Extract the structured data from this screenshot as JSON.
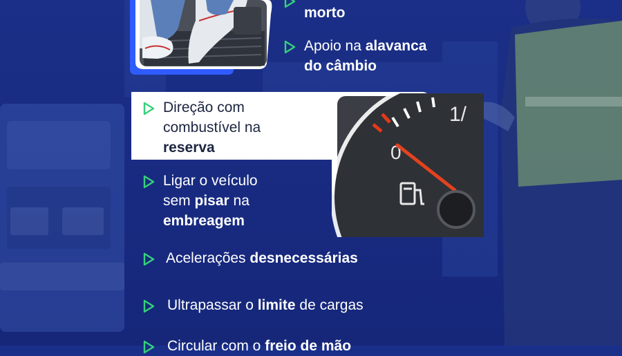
{
  "colors": {
    "background": "#1a2f8a",
    "accent_blue": "#2f5cff",
    "triangle_green": "#35d17a",
    "white_card": "#ffffff",
    "text_white": "#ffffff",
    "text_dark": "#1c2540"
  },
  "items": [
    {
      "parts": [
        "morto"
      ],
      "bold": [
        true
      ]
    },
    {
      "parts": [
        "Apoio na ",
        "alavanca",
        " do câmbio"
      ],
      "bold": [
        false,
        true,
        true
      ]
    },
    {
      "parts": [
        "Direção com combustível na ",
        "reserva"
      ],
      "bold": [
        false,
        true
      ]
    },
    {
      "parts": [
        "Ligar o veículo sem ",
        "pisar",
        " na ",
        "embreagem"
      ],
      "bold": [
        false,
        true,
        false,
        true
      ]
    },
    {
      "parts": [
        "Acelerações ",
        "desnecessárias"
      ],
      "bold": [
        false,
        true
      ]
    },
    {
      "parts": [
        "Ultrapassar o ",
        "limite",
        " de cargas"
      ],
      "bold": [
        false,
        true,
        false
      ]
    },
    {
      "parts": [
        "Circular com o ",
        "freio de mão"
      ],
      "bold": [
        false,
        true
      ]
    }
  ],
  "photos": {
    "pedals": {
      "subject": "feet-on-pedals-photo"
    },
    "fuel_gauge": {
      "subject": "fuel-gauge-photo",
      "gauge_text": [
        "0",
        "1/"
      ]
    }
  }
}
